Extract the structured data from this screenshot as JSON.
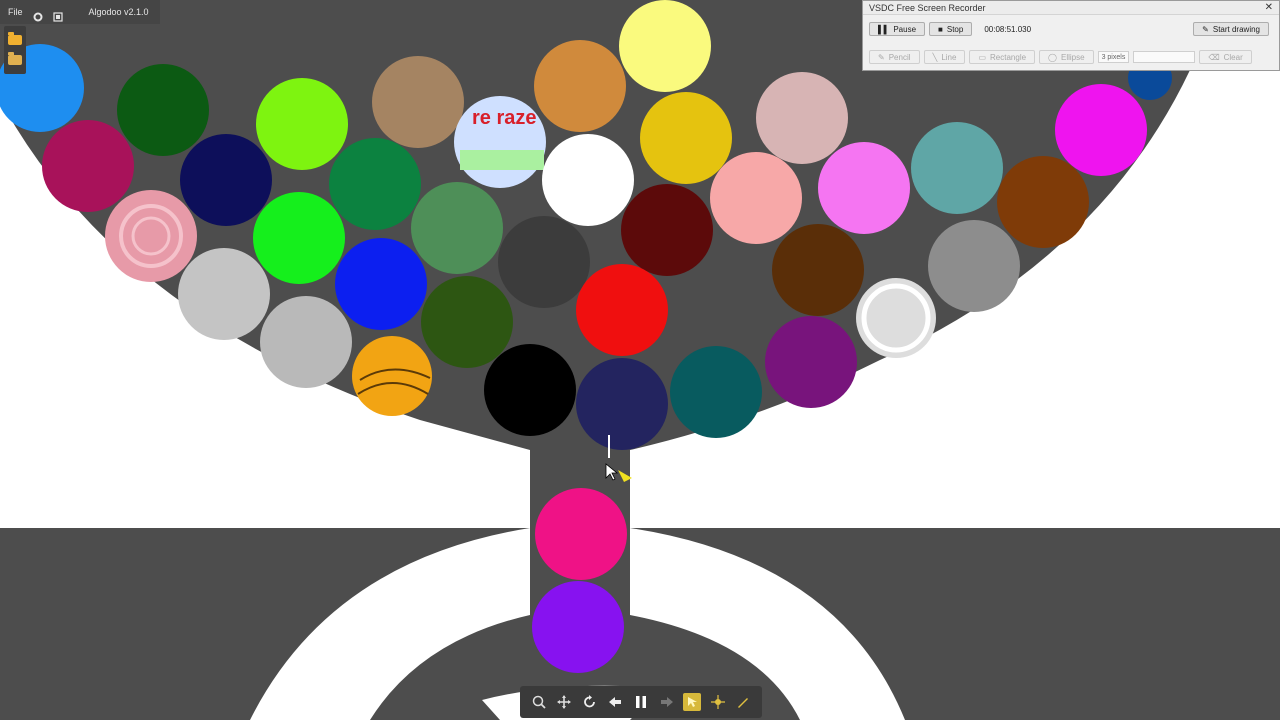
{
  "app": {
    "menu_file": "File",
    "title": "Algodoo v2.1.0"
  },
  "ball_text": "re raze",
  "recorder": {
    "title": "VSDC Free Screen Recorder",
    "close": "✕",
    "pause_label": "Pause",
    "stop_label": "Stop",
    "timer": "00:08:51.030",
    "start_drawing_label": "Start drawing",
    "pencil_label": "Pencil",
    "line_label": "Line",
    "rectangle_label": "Rectangle",
    "ellipse_label": "Ellipse",
    "pixels_value": "3 pixels",
    "clear_label": "Clear"
  }
}
